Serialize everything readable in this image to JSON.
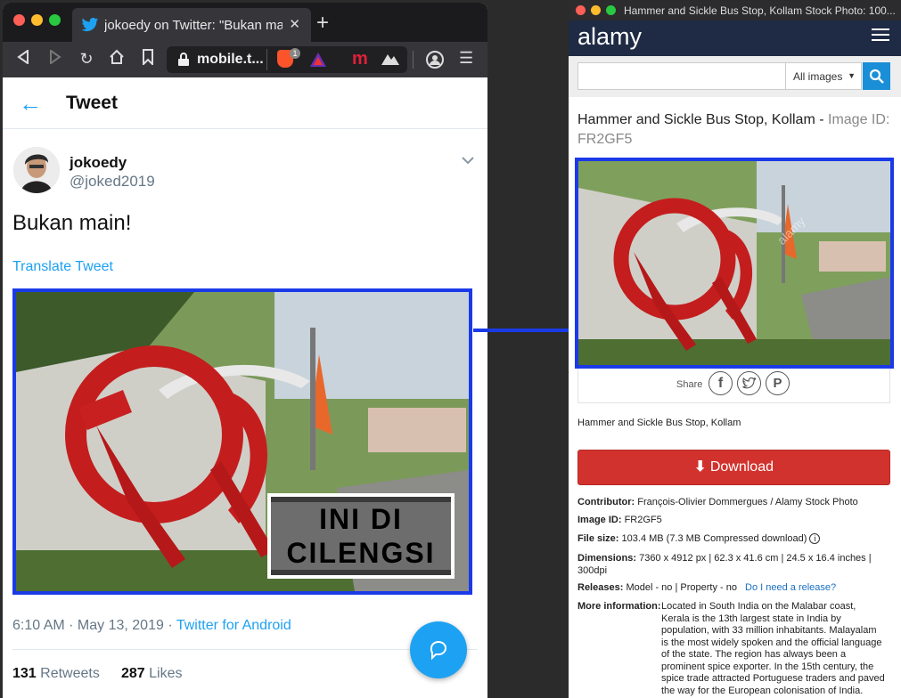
{
  "left_window": {
    "tab_title": "jokoedy on Twitter: \"Bukan main",
    "new_tab": "+",
    "url": "mobile.t...",
    "brave_badge": "1",
    "header_title": "Tweet",
    "author_name": "jokoedy",
    "author_handle": "@joked2019",
    "tweet_text": "Bukan main!",
    "translate_link": "Translate Tweet",
    "overlay_text_line1": "INI DI",
    "overlay_text_line2": "CILENGSI",
    "timestamp": "6:10 AM · May 13, 2019 · ",
    "source_link": "Twitter for Android",
    "retweets_count": "131",
    "retweets_label": "Retweets",
    "likes_count": "287",
    "likes_label": "Likes"
  },
  "right_window": {
    "window_title": "Hammer and Sickle Bus Stop, Kollam Stock Photo: 100...",
    "logo": "alamy",
    "search_scope": "All images",
    "image_title": "Hammer and Sickle Bus Stop, Kollam - ",
    "image_id_label": "Image ID:",
    "image_id_value": "FR2GF5",
    "share_label": "Share",
    "caption": "Hammer and Sickle Bus Stop, Kollam",
    "download_label": "Download",
    "contributor_label": "Contributor:",
    "contributor_value": "François-Olivier Dommergues / Alamy Stock Photo",
    "id_label": "Image ID:",
    "id_value": "FR2GF5",
    "filesize_label": "File size:",
    "filesize_value": "103.4 MB (7.3 MB Compressed download)",
    "dimensions_label": "Dimensions:",
    "dimensions_value": "7360 x 4912 px | 62.3 x 41.6 cm | 24.5 x 16.4 inches | 300dpi",
    "releases_label": "Releases:",
    "releases_value": "Model - no | Property - no",
    "release_link": "Do I need a release?",
    "more_label": "More information:",
    "more_value": "Located in South India on the Malabar coast, Kerala is the 13th largest state in India by population, with 33 million inhabitants. Malayalam is the most widely spoken and the official language of the state. The region has always been a prominent spice exporter. In the 15th century, the spice trade attracted Portuguese traders and paved the way for the European colonisation of India. Nowadays, the",
    "watermark": "alamy"
  },
  "colors": {
    "twitter_blue": "#1da1f2",
    "highlight_blue": "#1a3ae8",
    "alamy_navy": "#1f2b45",
    "alamy_search_blue": "#1a8fd8",
    "download_red": "#d2322d"
  }
}
